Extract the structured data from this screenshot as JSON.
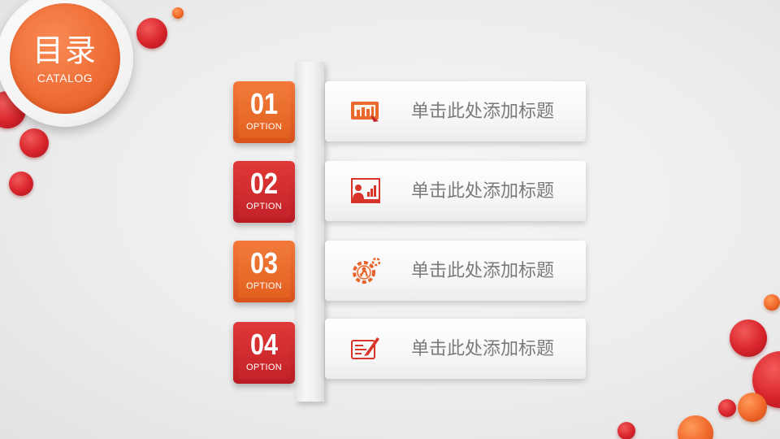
{
  "catalog": {
    "title": "目录",
    "subtitle": "CATALOG"
  },
  "items": [
    {
      "number": "01",
      "option": "OPTION",
      "title": "单击此处添加标题",
      "icon": "presentation-chart-icon",
      "tag_color": "#e8632a"
    },
    {
      "number": "02",
      "option": "OPTION",
      "title": "单击此处添加标题",
      "icon": "presenter-board-icon",
      "tag_color": "#c8262c"
    },
    {
      "number": "03",
      "option": "OPTION",
      "title": "单击此处添加标题",
      "icon": "gear-person-icon",
      "tag_color": "#e8632a"
    },
    {
      "number": "04",
      "option": "OPTION",
      "title": "单击此处添加标题",
      "icon": "sign-document-icon",
      "tag_color": "#c8262c"
    }
  ],
  "colors": {
    "accent_orange": "#ee6b33",
    "accent_red": "#d8242c",
    "text_gray": "#7a7a7a",
    "background": "#ececec"
  }
}
